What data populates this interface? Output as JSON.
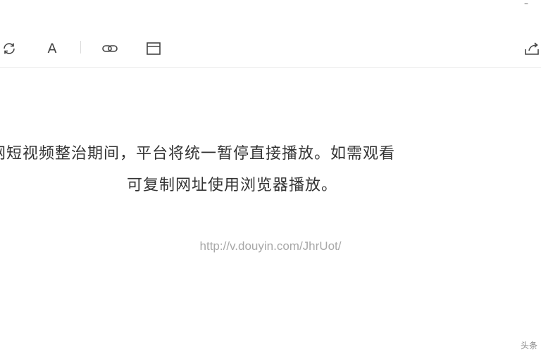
{
  "window": {
    "minimize_glyph": "–"
  },
  "toolbar": {
    "icons": [
      "refresh-icon",
      "font-icon",
      "link-icon",
      "window-icon",
      "share-icon"
    ],
    "font_label": "A"
  },
  "notice": {
    "line1": "网短视频整治期间，平台将统一暂停直接播放。如需观看",
    "line2": "可复制网址使用浏览器播放。"
  },
  "link": {
    "url": "http://v.douyin.com/JhrUot/"
  },
  "watermark": {
    "text": "头条"
  },
  "colors": {
    "text": "#333333",
    "url": "#a8a8a8",
    "icon": "#444444",
    "divider": "#ebebeb"
  }
}
